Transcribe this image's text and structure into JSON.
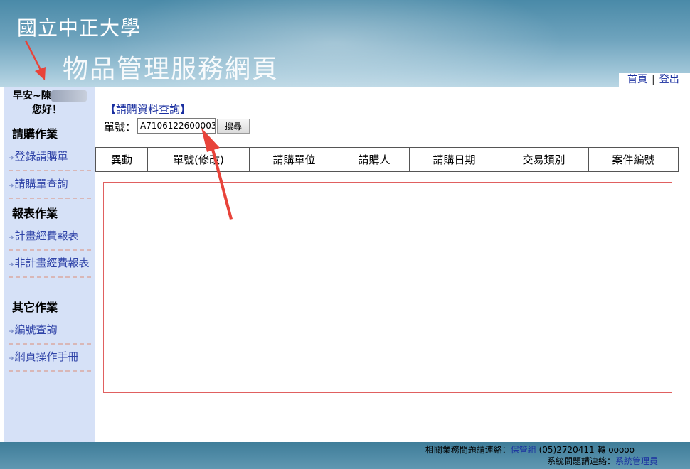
{
  "header": {
    "university": "國立中正大學",
    "site_title": "物品管理服務網頁",
    "nav_home": "首頁",
    "nav_separator": "|",
    "nav_logout": "登出"
  },
  "sidebar": {
    "greeting_prefix": "早安~陳",
    "greeting_suffix": "您好！",
    "sections": [
      {
        "title": "請購作業",
        "items": [
          {
            "label": "登錄請購單"
          },
          {
            "label": "請購單查詢"
          }
        ]
      },
      {
        "title": "報表作業",
        "items": [
          {
            "label": "計畫經費報表"
          },
          {
            "label": "非計畫經費報表"
          }
        ]
      },
      {
        "title": "其它作業",
        "items": [
          {
            "label": "編號查詢"
          },
          {
            "label": "網頁操作手冊"
          }
        ]
      }
    ]
  },
  "query": {
    "title": "【請購資料查詢】",
    "label": "單號：",
    "value": "A7106122600003",
    "search_label": "搜尋"
  },
  "table": {
    "columns": [
      "異動",
      "單號(修改)",
      "請購單位",
      "請購人",
      "請購日期",
      "交易類別",
      "案件編號"
    ]
  },
  "footer": {
    "line1_prefix": "相關業務問題請連絡：",
    "line1_link": "保管組",
    "line1_phone": " (05)2720411 轉 ooooo",
    "line2_prefix": "系統問題請連絡：",
    "line2_link": "系統管理員"
  },
  "colors": {
    "link": "#1a2fa0",
    "sidebar_bg": "#d6e1f7",
    "annotation_arrow": "#e8433a"
  }
}
